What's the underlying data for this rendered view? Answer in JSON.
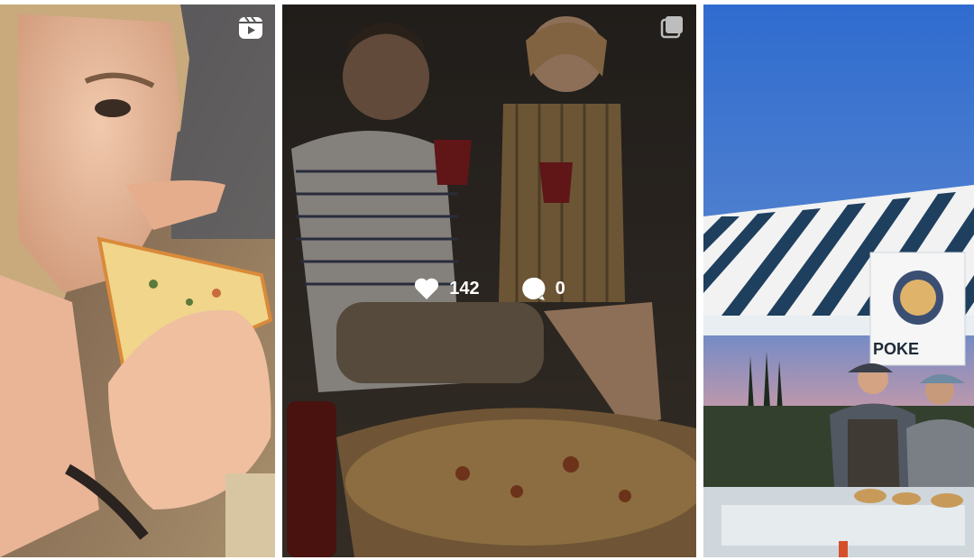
{
  "posts": [
    {
      "media_type": "reel",
      "badge_icon": "reels-icon"
    },
    {
      "media_type": "carousel",
      "badge_icon": "carousel-icon",
      "hover": true,
      "likes": "142",
      "comments": "0"
    },
    {
      "media_type": "photo",
      "sign_text": "POKE"
    }
  ],
  "colors": {
    "overlay_text": "#ffffff",
    "awning_stripe": "#1f3f5e",
    "sky": "#3f74c6"
  }
}
